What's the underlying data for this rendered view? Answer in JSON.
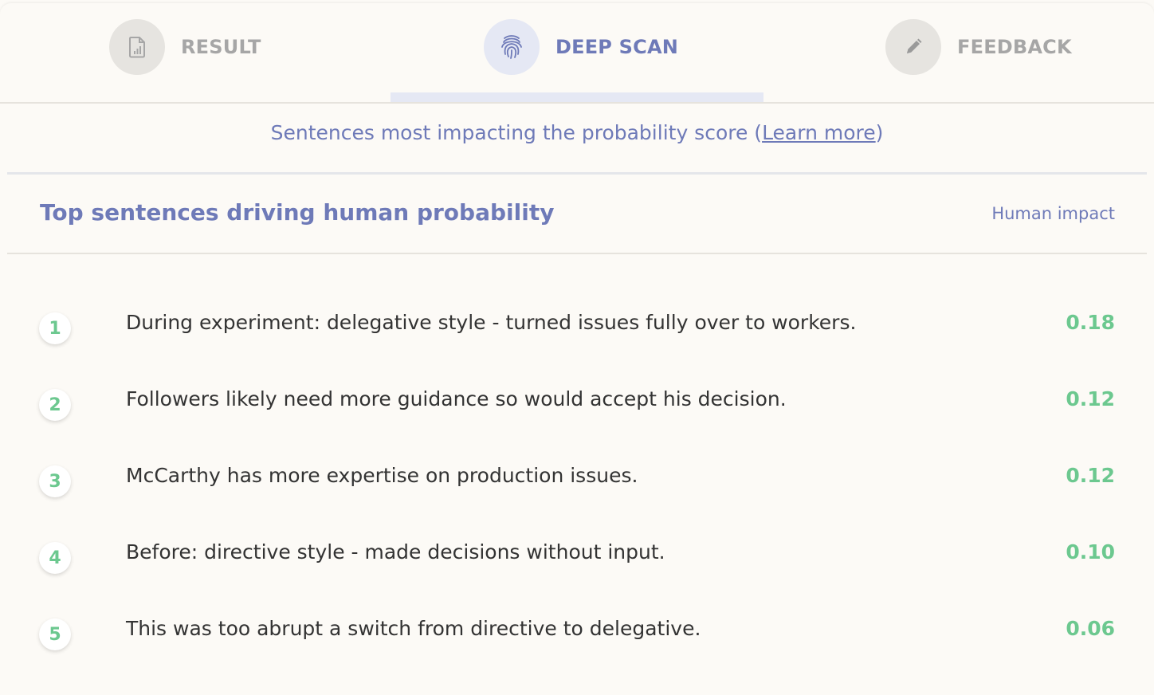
{
  "tabs": [
    {
      "label": "RESULT",
      "icon": "document-chart-icon",
      "active": false
    },
    {
      "label": "DEEP SCAN",
      "icon": "fingerprint-icon",
      "active": true
    },
    {
      "label": "FEEDBACK",
      "icon": "pencil-icon",
      "active": false
    }
  ],
  "subtitle": {
    "text": "Sentences most impacting the probability score (",
    "link": "Learn more",
    "close": ")"
  },
  "section": {
    "title": "Top sentences driving human probability",
    "column_label": "Human impact"
  },
  "sentences": [
    {
      "rank": "1",
      "text": "During experiment: delegative style - turned issues fully over to workers.",
      "impact": "0.18"
    },
    {
      "rank": "2",
      "text": "Followers likely need more guidance so would accept his decision.",
      "impact": "0.12"
    },
    {
      "rank": "3",
      "text": "McCarthy has more expertise on production issues.",
      "impact": "0.12"
    },
    {
      "rank": "4",
      "text": "Before: directive style - made decisions without input.",
      "impact": "0.10"
    },
    {
      "rank": "5",
      "text": "This was too abrupt a switch from directive to delegative.",
      "impact": "0.06"
    }
  ],
  "colors": {
    "accent": "#6e7ab8",
    "positive": "#6cc88f",
    "inactive": "#a6a6a6",
    "background": "#fcfaf6"
  }
}
